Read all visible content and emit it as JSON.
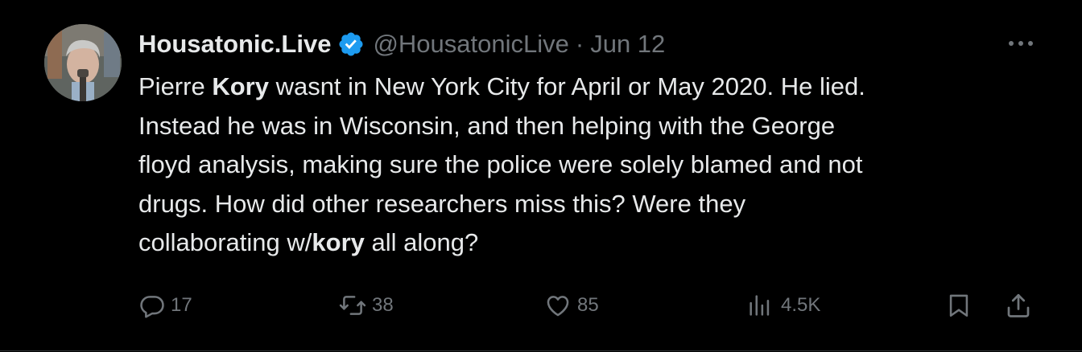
{
  "tweet": {
    "author_name": "Housatonic.Live",
    "handle": "@HousatonicLive",
    "separator": "·",
    "date": "Jun 12",
    "body": [
      {
        "text": "Pierre ",
        "bold": false
      },
      {
        "text": "Kory",
        "bold": true
      },
      {
        "text": " wasnt in New York City for April or May 2020. He lied.",
        "bold": false
      },
      {
        "text": "Instead he was in Wisconsin, and then helping with the George",
        "bold": false
      },
      {
        "text": "floyd analysis, making sure the police were solely blamed and not",
        "bold": false
      },
      {
        "text": "drugs. How did other researchers miss this? Were they",
        "bold": false
      },
      {
        "text": "collaborating w/",
        "bold": false
      },
      {
        "text": "kory",
        "bold": true
      },
      {
        "text": " all along?",
        "bold": false
      }
    ],
    "stats": {
      "replies": "17",
      "reposts": "38",
      "likes": "85",
      "views": "4.5K"
    }
  },
  "icons": {
    "verified": "verified-badge-icon",
    "more": "more-icon",
    "reply": "reply-icon",
    "repost": "repost-icon",
    "like": "like-icon",
    "views": "views-icon",
    "bookmark": "bookmark-icon",
    "share": "share-icon"
  },
  "colors": {
    "background": "#000000",
    "text": "#e7e9ea",
    "muted": "#71767b",
    "verified": "#1d9bf0"
  }
}
